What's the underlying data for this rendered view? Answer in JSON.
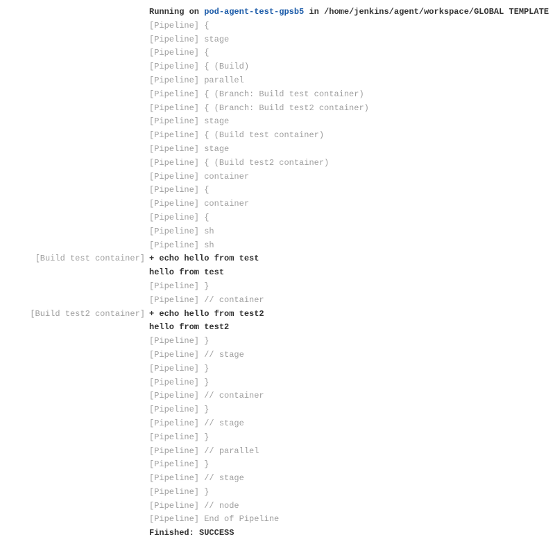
{
  "header": {
    "running_on_text": "Running on ",
    "node_name": "pod-agent-test-gpsb5",
    "in_text": " in ",
    "workspace_path": "/home/jenkins/agent/workspace/GLOBAL TEMPLATE"
  },
  "pipeline_prefix": "[Pipeline] ",
  "branch_labels": {
    "test": "[Build test container]",
    "test2": "[Build test2 container]"
  },
  "lines": [
    {
      "margin": "",
      "type": "pipe",
      "action": "{"
    },
    {
      "margin": "",
      "type": "pipe",
      "action": "stage"
    },
    {
      "margin": "",
      "type": "pipe",
      "action": "{"
    },
    {
      "margin": "",
      "type": "pipe",
      "action": "{ (Build)"
    },
    {
      "margin": "",
      "type": "pipe",
      "action": "parallel"
    },
    {
      "margin": "",
      "type": "pipe",
      "action": "{ (Branch: Build test container)"
    },
    {
      "margin": "",
      "type": "pipe",
      "action": "{ (Branch: Build test2 container)"
    },
    {
      "margin": "",
      "type": "pipe",
      "action": "stage"
    },
    {
      "margin": "",
      "type": "pipe",
      "action": "{ (Build test container)"
    },
    {
      "margin": "",
      "type": "pipe",
      "action": "stage"
    },
    {
      "margin": "",
      "type": "pipe",
      "action": "{ (Build test2 container)"
    },
    {
      "margin": "",
      "type": "pipe",
      "action": "container"
    },
    {
      "margin": "",
      "type": "pipe",
      "action": "{"
    },
    {
      "margin": "",
      "type": "pipe",
      "action": "container"
    },
    {
      "margin": "",
      "type": "pipe",
      "action": "{"
    },
    {
      "margin": "",
      "type": "pipe",
      "action": "sh"
    },
    {
      "margin": "",
      "type": "pipe",
      "action": "sh"
    },
    {
      "margin": "test",
      "type": "boldplain",
      "text": "+ echo hello from test"
    },
    {
      "margin": "",
      "type": "boldplain",
      "text": "hello from test"
    },
    {
      "margin": "",
      "type": "pipe",
      "action": "}"
    },
    {
      "margin": "",
      "type": "pipe",
      "action": "// container"
    },
    {
      "margin": "test2",
      "type": "boldplain",
      "text": "+ echo hello from test2"
    },
    {
      "margin": "",
      "type": "boldplain",
      "text": "hello from test2"
    },
    {
      "margin": "",
      "type": "pipe",
      "action": "}"
    },
    {
      "margin": "",
      "type": "pipe",
      "action": "// stage"
    },
    {
      "margin": "",
      "type": "pipe",
      "action": "}"
    },
    {
      "margin": "",
      "type": "pipe",
      "action": "}"
    },
    {
      "margin": "",
      "type": "pipe",
      "action": "// container"
    },
    {
      "margin": "",
      "type": "pipe",
      "action": "}"
    },
    {
      "margin": "",
      "type": "pipe",
      "action": "// stage"
    },
    {
      "margin": "",
      "type": "pipe",
      "action": "}"
    },
    {
      "margin": "",
      "type": "pipe",
      "action": "// parallel"
    },
    {
      "margin": "",
      "type": "pipe",
      "action": "}"
    },
    {
      "margin": "",
      "type": "pipe",
      "action": "// stage"
    },
    {
      "margin": "",
      "type": "pipe",
      "action": "}"
    },
    {
      "margin": "",
      "type": "pipe",
      "action": "// node"
    },
    {
      "margin": "",
      "type": "pipe",
      "action": "End of Pipeline"
    },
    {
      "margin": "",
      "type": "boldplain",
      "text": "Finished: SUCCESS"
    }
  ]
}
